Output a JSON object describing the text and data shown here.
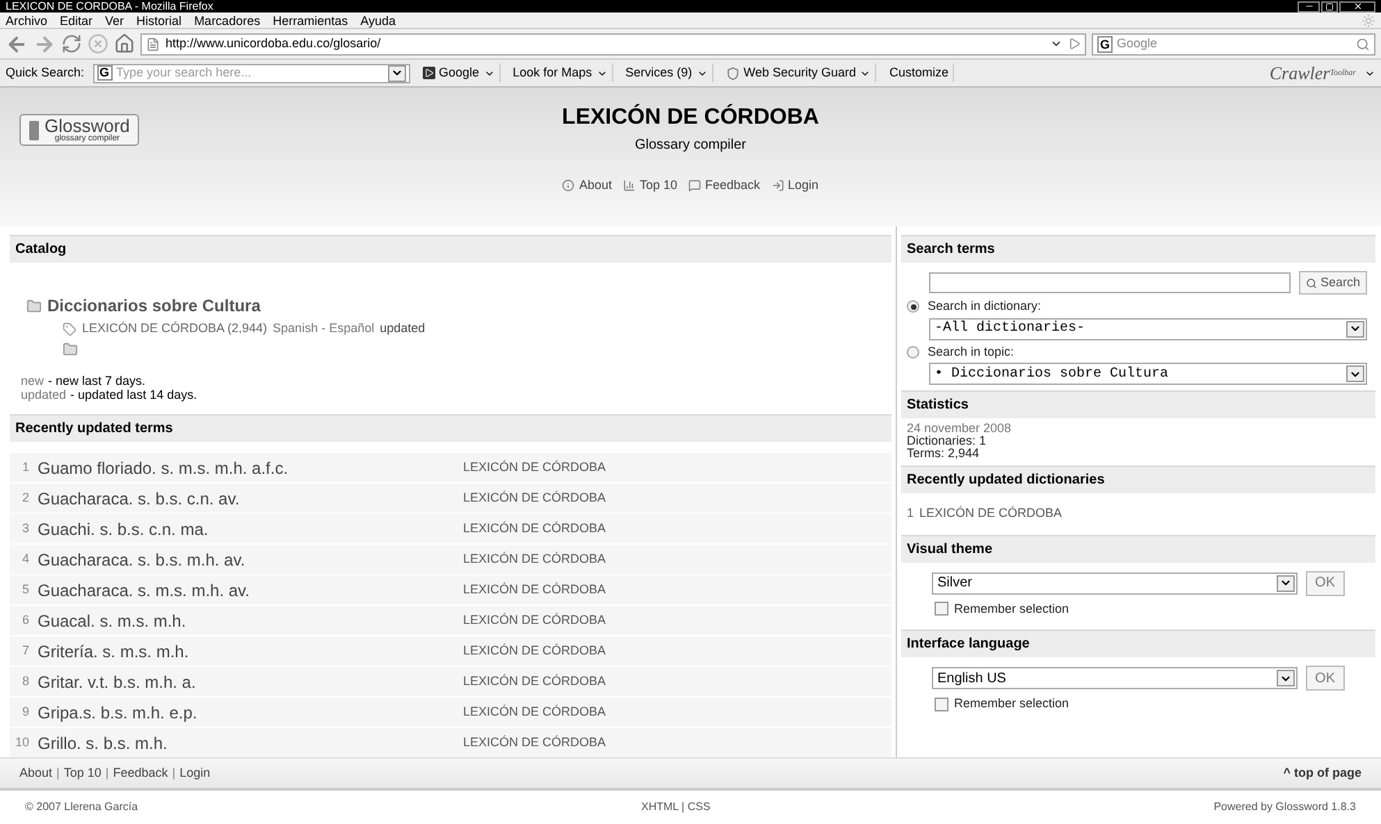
{
  "window": {
    "title": "LEXICON DE CORDOBA - Mozilla Firefox"
  },
  "menu": [
    "Archivo",
    "Editar",
    "Ver",
    "Historial",
    "Marcadores",
    "Herramientas",
    "Ayuda"
  ],
  "navbar": {
    "url": "http://www.unicordoba.edu.co/glosario/",
    "engine": "G",
    "search_placeholder": "Google"
  },
  "toolbar": {
    "label": "Quick Search:",
    "engine": "G",
    "placeholder": "Type your search here...",
    "items": [
      {
        "label": "Google",
        "kind": "play"
      },
      {
        "label": "Look for Maps",
        "kind": "plain"
      },
      {
        "label": "Services (9)",
        "kind": "plain"
      },
      {
        "label": "Web Security Guard",
        "kind": "shield"
      },
      {
        "label": "Customize",
        "kind": "nodrop"
      }
    ],
    "brand": "Crawler",
    "brand_sub": "Toolbar"
  },
  "header": {
    "logo": "Glossword",
    "logo_sub": "glossary compiler",
    "title": "LEXICÓN DE CÓRDOBA",
    "subtitle": "Glossary compiler",
    "links": [
      "About",
      "Top 10",
      "Feedback",
      "Login"
    ]
  },
  "catalog": {
    "title": "Catalog",
    "topic": "Diccionarios sobre Cultura",
    "dictionary": "LEXICÓN DE CÓRDOBA (2,944)",
    "language": "Spanish - Español",
    "badge": "updated",
    "legend": [
      {
        "term": "new",
        "desc": "- new last 7 days."
      },
      {
        "term": "updated",
        "desc": "- updated last 14 days."
      }
    ]
  },
  "recent_terms": {
    "title": "Recently updated terms",
    "rows": [
      {
        "num": "1",
        "term": "Guamo floriado. s. m.s. m.h. a.f.c.",
        "dictionary": "LEXICÓN DE CÓRDOBA"
      },
      {
        "num": "2",
        "term": "Guacharaca. s. b.s. c.n. av.",
        "dictionary": "LEXICÓN DE CÓRDOBA"
      },
      {
        "num": "3",
        "term": "Guachi. s. b.s. c.n. ma.",
        "dictionary": "LEXICÓN DE CÓRDOBA"
      },
      {
        "num": "4",
        "term": "Guacharaca. s. b.s. m.h. av.",
        "dictionary": "LEXICÓN DE CÓRDOBA"
      },
      {
        "num": "5",
        "term": "Guacharaca. s. m.s. m.h. av.",
        "dictionary": "LEXICÓN DE CÓRDOBA"
      },
      {
        "num": "6",
        "term": "Guacal. s. m.s. m.h.",
        "dictionary": "LEXICÓN DE CÓRDOBA"
      },
      {
        "num": "7",
        "term": "Gritería. s. m.s. m.h.",
        "dictionary": "LEXICÓN DE CÓRDOBA"
      },
      {
        "num": "8",
        "term": "Gritar. v.t. b.s. m.h. a.",
        "dictionary": "LEXICÓN DE CÓRDOBA"
      },
      {
        "num": "9",
        "term": "Gripa.s. b.s. m.h. e.p.",
        "dictionary": "LEXICÓN DE CÓRDOBA"
      },
      {
        "num": "10",
        "term": "Grillo. s. b.s. m.h.",
        "dictionary": "LEXICÓN DE CÓRDOBA"
      }
    ]
  },
  "search_terms": {
    "title": "Search terms",
    "button": "Search",
    "options": [
      {
        "label": "Search in dictionary:",
        "selected": true,
        "value": "-All dictionaries-"
      },
      {
        "label": "Search in topic:",
        "selected": false,
        "value": "• Diccionarios sobre Cultura"
      }
    ]
  },
  "statistics": {
    "title": "Statistics",
    "date": "24 november 2008",
    "lines": [
      "Dictionaries: 1",
      "Terms: 2,944"
    ]
  },
  "recent_dictionaries": {
    "title": "Recently updated dictionaries",
    "items": [
      {
        "num": "1",
        "name": "LEXICÓN DE CÓRDOBA"
      }
    ]
  },
  "visual_theme": {
    "title": "Visual theme",
    "value": "Silver",
    "button": "OK",
    "remember": {
      "label": "Remember selection",
      "checked": false
    }
  },
  "interface_language": {
    "title": "Interface language",
    "value": "English US",
    "button": "OK",
    "remember": {
      "label": "Remember selection",
      "checked": false
    }
  },
  "footer": {
    "links": [
      "About",
      "Top 10",
      "Feedback",
      "Login"
    ],
    "separator": "|",
    "top": "^ top of page"
  },
  "bottom": {
    "copyright": "© 2007 Llerena García",
    "validators": "XHTML | CSS",
    "powered": "Powered by Glossword 1.8.3"
  }
}
